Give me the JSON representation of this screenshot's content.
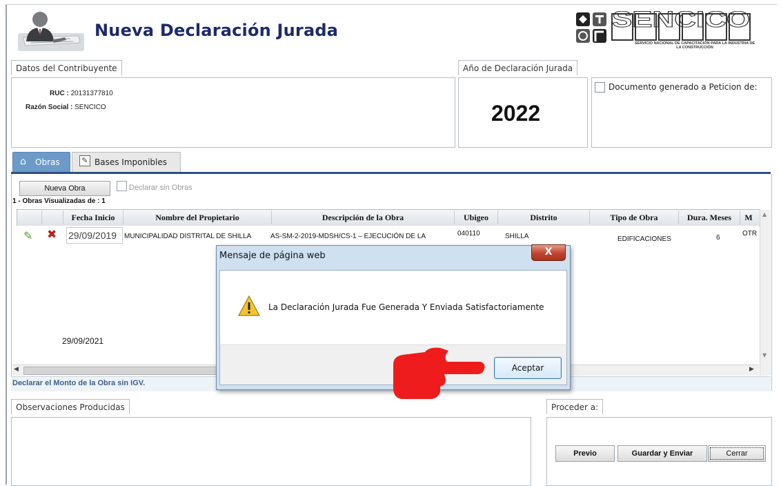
{
  "header": {
    "title": "Nueva Declaración Jurada",
    "logo_text": "SENCICO",
    "logo_subtitle": "SERVICIO NACIONAL DE CAPACITACIÓN PARA LA INDUSTRIA DE LA CONSTRUCCIÓN"
  },
  "contribuyente": {
    "legend": "Datos del Contribuyente",
    "ruc_label": "RUC :",
    "ruc_value": "20131377810",
    "razon_label": "Razón Social :",
    "razon_value": "SENCICO"
  },
  "anio": {
    "legend": "Año de Declaración Jurada",
    "value": "2022"
  },
  "peticion": {
    "checkbox_label": "Documento generado a Peticion de:"
  },
  "tabs": [
    {
      "label": "Obras",
      "icon": "home-icon",
      "active": true
    },
    {
      "label": "Bases Imponibles",
      "icon": "edit-icon",
      "active": false
    }
  ],
  "obras": {
    "new_button": "Nueva Obra",
    "no_obras_label": "Declarar sin Obras",
    "count_text": "1 - Obras Visualizadas de : 1",
    "columns": [
      "Fecha Inicio",
      "Nombre del Propietario",
      "Descripción de la Obra",
      "Ubigeo",
      "Distrito",
      "Tipo de Obra",
      "Dura. Meses",
      "M"
    ],
    "row": {
      "fecha": "29/09/2019",
      "propietario": "MUNICIPALIDAD DISTRITAL DE SHILLA",
      "descripcion": "AS-SM-2-2019-MDSH/CS-1 – EJECUCIÓN DE LA",
      "ubigeo": "040110",
      "distrito": "SHILLA",
      "tipo": "EDIFICACIONES",
      "meses": "6",
      "m": "OTR"
    },
    "date_note": "29/09/2021",
    "footer_note": "Declarar el Monto de la Obra sin IGV."
  },
  "dialog": {
    "title": "Mensaje de página web",
    "message": "La Declaración Jurada Fue Generada Y Enviada Satisfactoriamente",
    "ok": "Aceptar",
    "close": "X"
  },
  "observaciones": {
    "legend": "Observaciones Producidas"
  },
  "proceder": {
    "legend": "Proceder a:",
    "buttons": [
      "Previo",
      "Guardar y Enviar",
      "Cerrar"
    ]
  },
  "colors": {
    "title": "#1c2a6b",
    "tab_active": "#6c9bc9",
    "tab_line": "#2d4e86",
    "close_button": "#c0442d",
    "pointer_hand": "#ee1c1c"
  }
}
